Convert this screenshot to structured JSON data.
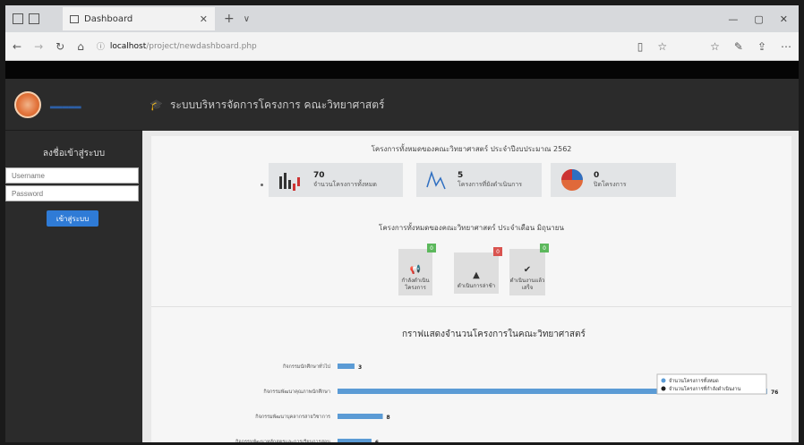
{
  "browser": {
    "tab_title": "Dashboard",
    "tab_close": "✕",
    "new_tab": "+",
    "url_host": "localhost",
    "url_path": "/project/newdashboard.php",
    "nav": {
      "back": "←",
      "forward": "→",
      "refresh": "↻",
      "home": "⌂"
    },
    "toolbar": {
      "read": "▯",
      "favorite": "☆",
      "favorites": "☆",
      "pen": "✎",
      "share": "⇪",
      "more": "⋯"
    },
    "window": {
      "minimize": "—",
      "maximize": "▢",
      "close": "✕"
    }
  },
  "sidebar": {
    "login_title": "ลงชื่อเข้าสู่ระบบ",
    "username_placeholder": "Username",
    "password_placeholder": "Password",
    "login_button": "เข้าสู่ระบบ"
  },
  "header": {
    "title": "ระบบบริหารจัดการโครงการ คณะวิทยาศาสตร์"
  },
  "summary": {
    "title": "โครงการทั้งหมดของคณะวิทยาศาสตร์ ประจำปีงบประมาณ 2562",
    "stats": [
      {
        "value": "70",
        "label": "จำนวนโครงการทั้งหมด",
        "icon": "bar-chart-icon"
      },
      {
        "value": "5",
        "label": "โครงการที่ยังดำเนินการ",
        "icon": "line-chart-icon"
      },
      {
        "value": "0",
        "label": "ปิดโครงการ",
        "icon": "pie-chart-icon"
      }
    ]
  },
  "status": {
    "title": "โครงการทั้งหมดของคณะวิทยาศาสตร์ ประจำเดือน มิถุนายน",
    "cards": [
      {
        "label1": "กำลังดำเนิน",
        "label2": "โครงการ",
        "badge": "0",
        "badge_color": "#5cb85c",
        "icon": "megaphone-icon"
      },
      {
        "label1": "ดำเนินการล่าช้า",
        "label2": "",
        "badge": "0",
        "badge_color": "#d9534f",
        "icon": "warning-icon"
      },
      {
        "label1": "ดำเนินงานแล้ว",
        "label2": "เสร็จ",
        "badge": "0",
        "badge_color": "#5cb85c",
        "icon": "check-icon"
      }
    ]
  },
  "chart_data": {
    "type": "bar",
    "title": "กราฟแสดงจำนวนโครงการในคณะวิทยาศาสตร์",
    "categories": [
      "กิจกรรมนักศึกษาทั่วไป",
      "กิจกรรมพัฒนาคุณภาพนักศึกษา",
      "กิจกรรมพัฒนาบุคลากรสายวิชาการ",
      "กิจกรรมพัฒนาหลักสูตรและการเรียนการสอน"
    ],
    "series": [
      {
        "name": "จำนวนโครงการทั้งหมด",
        "values": [
          3,
          76,
          8,
          6
        ],
        "color": "#5b9bd5"
      },
      {
        "name": "จำนวนโครงการที่กำลังดำเนินงาน",
        "values": [
          0,
          0,
          0,
          0
        ],
        "color": "#222222"
      }
    ],
    "xlim": [
      0,
      76
    ],
    "legend_position": "right"
  }
}
